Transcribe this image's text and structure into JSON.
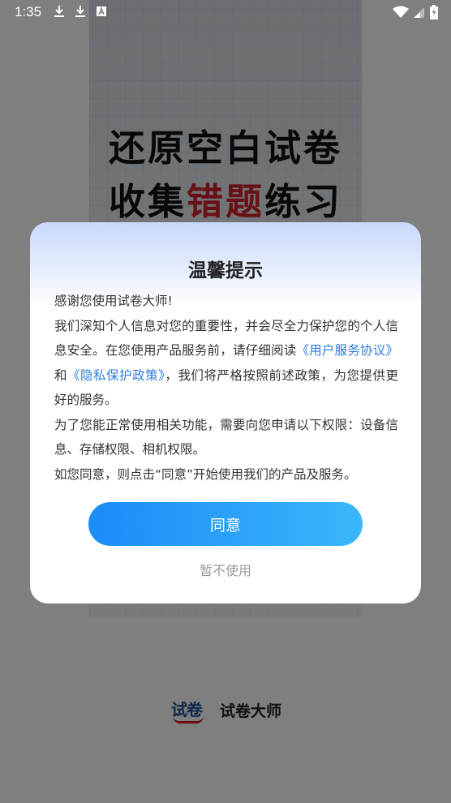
{
  "status_bar": {
    "time": "1:35",
    "left_icons": [
      "download-icon",
      "download-icon",
      "font-icon"
    ],
    "right_icons": [
      "wifi-icon",
      "signal-icon",
      "battery-icon"
    ]
  },
  "splash": {
    "headline_line1": "还原空白试卷",
    "headline_line2_part1": "收集",
    "headline_line2_accent": "错题",
    "headline_line2_part2": "练习",
    "accent_color": "#d0202a",
    "brand_logo_text": "试卷",
    "brand_name": "试卷大师"
  },
  "dialog": {
    "title": "温馨提示",
    "greeting": "感谢您使用试卷大师!",
    "p1_before": "我们深知个人信息对您的重要性，并会尽全力保护您的个人信息安全。在您使用产品服务前，请仔细阅读",
    "link_user_agreement": "《用户服务协议》",
    "p1_and": "和",
    "link_privacy_policy": "《隐私保护政策》",
    "p1_after": "，我们将严格按照前述政策，为您提供更好的服务。",
    "p2": "为了您能正常使用相关功能，需要向您申请以下权限：设备信息、存储权限、相机权限。",
    "p3": "如您同意，则点击“同意”开始使用我们的产品及服务。",
    "agree_label": "同意",
    "decline_label": "暂不使用",
    "link_color": "#2e7be0",
    "button_gradient": [
      "#1a8cf7",
      "#3bb6fb"
    ]
  }
}
